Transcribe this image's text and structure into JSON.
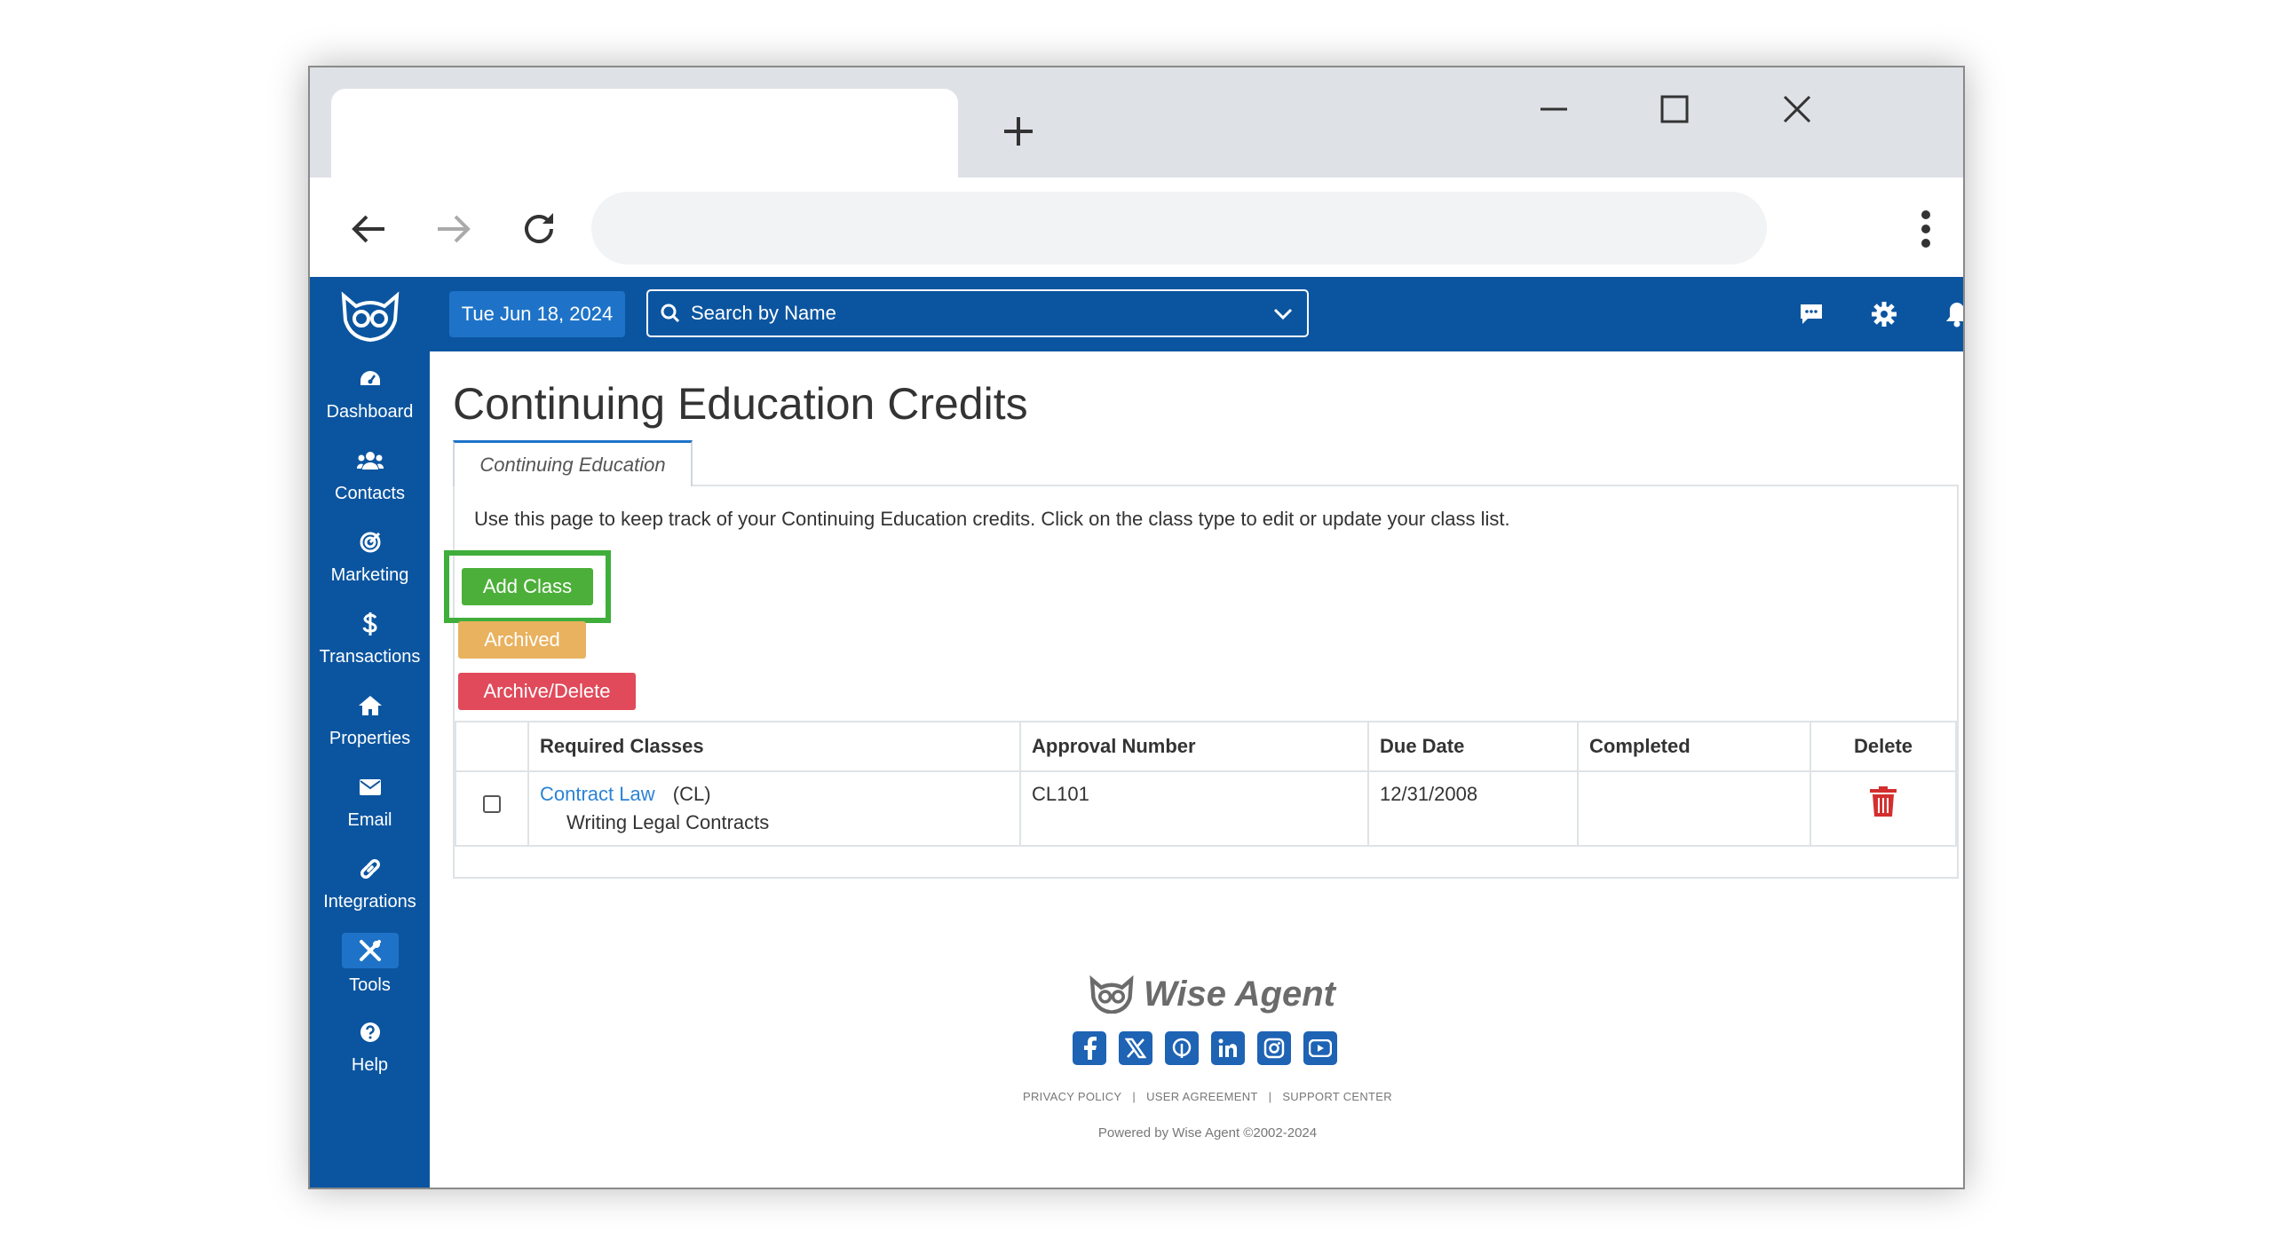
{
  "app": {
    "date": "Tue Jun 18, 2024",
    "search_placeholder": "Search by Name"
  },
  "sidebar": {
    "items": [
      {
        "label": "Dashboard",
        "icon": "dashboard-icon"
      },
      {
        "label": "Contacts",
        "icon": "contacts-icon"
      },
      {
        "label": "Marketing",
        "icon": "marketing-icon"
      },
      {
        "label": "Transactions",
        "icon": "dollar-icon"
      },
      {
        "label": "Properties",
        "icon": "home-icon"
      },
      {
        "label": "Email",
        "icon": "envelope-icon"
      },
      {
        "label": "Integrations",
        "icon": "link-icon"
      },
      {
        "label": "Tools",
        "icon": "tools-icon",
        "active": true
      },
      {
        "label": "Help",
        "icon": "help-icon"
      }
    ]
  },
  "page": {
    "title": "Continuing Education Credits",
    "tab_label": "Continuing Education",
    "description": "Use this page to keep track of your Continuing Education credits. Click on the class type to edit or update your class list.",
    "buttons": {
      "add": "Add Class",
      "archived": "Archived",
      "archive_delete": "Archive/Delete"
    }
  },
  "table": {
    "headers": [
      "",
      "Required Classes",
      "Approval Number",
      "Due Date",
      "Completed",
      "Delete"
    ],
    "rows": [
      {
        "class_name": "Contract Law",
        "class_code": "(CL)",
        "class_desc": "Writing Legal Contracts",
        "approval_number": "CL101",
        "due_date": "12/31/2008",
        "completed": ""
      }
    ]
  },
  "footer": {
    "brand": "Wise Agent",
    "social": [
      "facebook-icon",
      "x-icon",
      "pinterest-icon",
      "linkedin-icon",
      "instagram-icon",
      "youtube-icon"
    ],
    "links": [
      "PRIVACY POLICY",
      "USER AGREEMENT",
      "SUPPORT CENTER"
    ],
    "separator": "|",
    "powered": "Powered by Wise Agent ©2002-2024"
  },
  "colors": {
    "brand_blue": "#0b55a0",
    "accent_blue": "#1e73c8",
    "add_green": "#4caf39",
    "archived_orange": "#e9b25f",
    "delete_red": "#e04a5a",
    "highlight_green": "#3fae3b"
  }
}
